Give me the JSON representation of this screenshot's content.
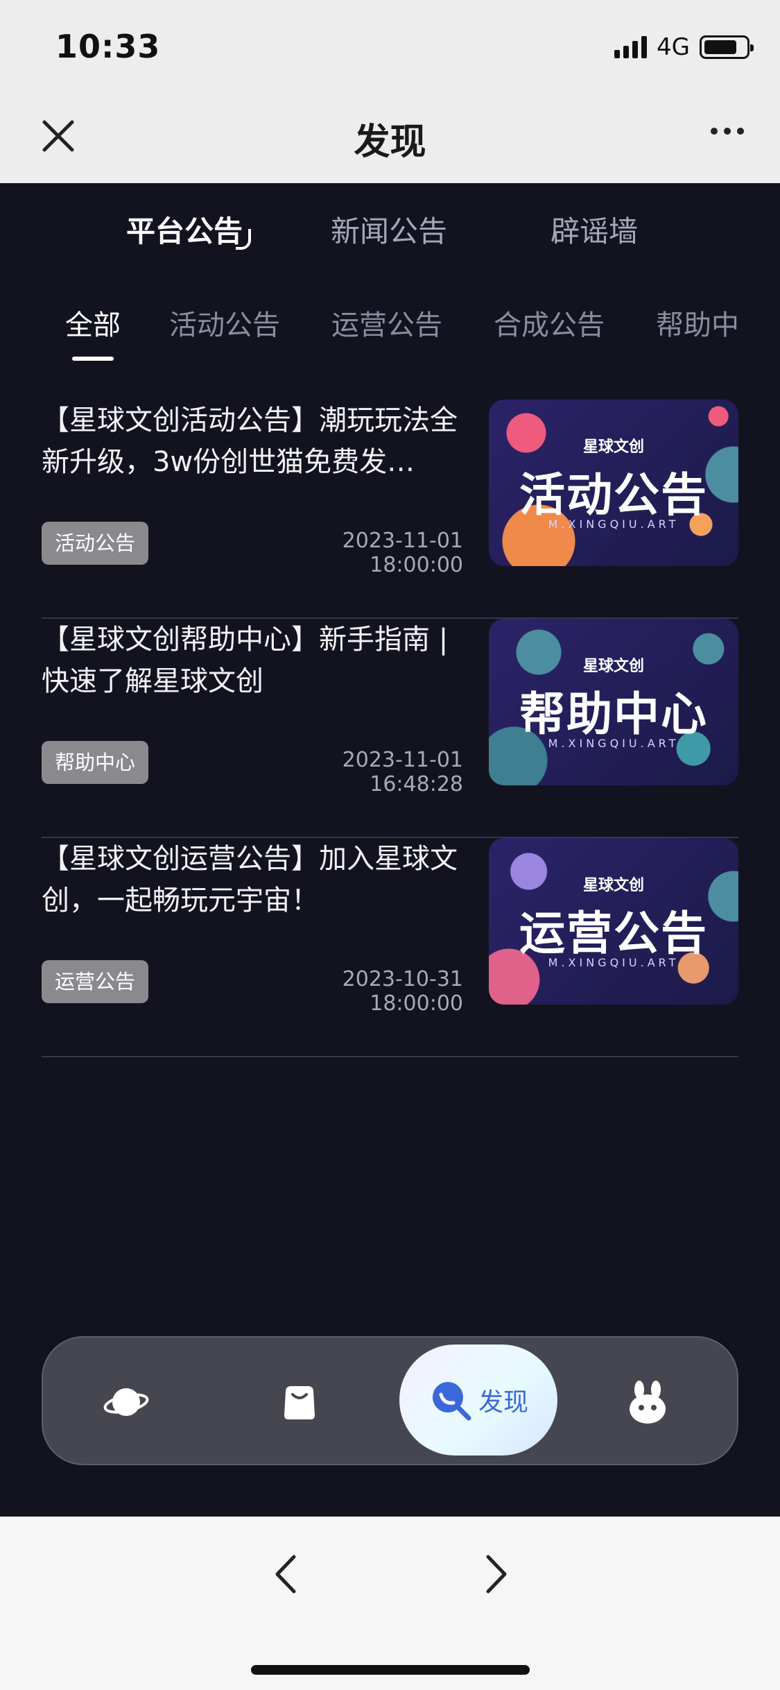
{
  "status_bar": {
    "time": "10:33",
    "network": "4G"
  },
  "header": {
    "title": "发现"
  },
  "primary_tabs": [
    "平台公告",
    "新闻公告",
    "辟谣墙"
  ],
  "sub_tabs": [
    "全部",
    "活动公告",
    "运营公告",
    "合成公告",
    "帮助中"
  ],
  "articles": [
    {
      "title": "【星球文创活动公告】潮玩玩法全新升级，3w份创世猫免费发…",
      "tag": "活动公告",
      "time": "2023-11-01 18:00:00",
      "thumb": {
        "logo": "星球文创",
        "text": "活动公告",
        "sub": "M.XINGQIU.ART"
      }
    },
    {
      "title": "【星球文创帮助中心】新手指南 | 快速了解星球文创",
      "tag": "帮助中心",
      "time": "2023-11-01 16:48:28",
      "thumb": {
        "logo": "星球文创",
        "text": "帮助中心",
        "sub": "M.XINGQIU.ART"
      }
    },
    {
      "title": "【星球文创运营公告】加入星球文创，一起畅玩元宇宙！",
      "tag": "运营公告",
      "time": "2023-10-31 18:00:00",
      "thumb": {
        "logo": "星球文创",
        "text": "运营公告",
        "sub": "M.XINGQIU.ART"
      }
    }
  ],
  "bottom_nav": {
    "items": [
      {
        "icon": "planet-icon"
      },
      {
        "icon": "shopping-bag-icon"
      },
      {
        "icon": "discover-search-icon",
        "label": "发现",
        "active": true
      },
      {
        "icon": "bunny-profile-icon"
      }
    ]
  },
  "colors": {
    "background": "#12131f",
    "accent": "#3b68d9",
    "badge": "#8a8a8e"
  }
}
